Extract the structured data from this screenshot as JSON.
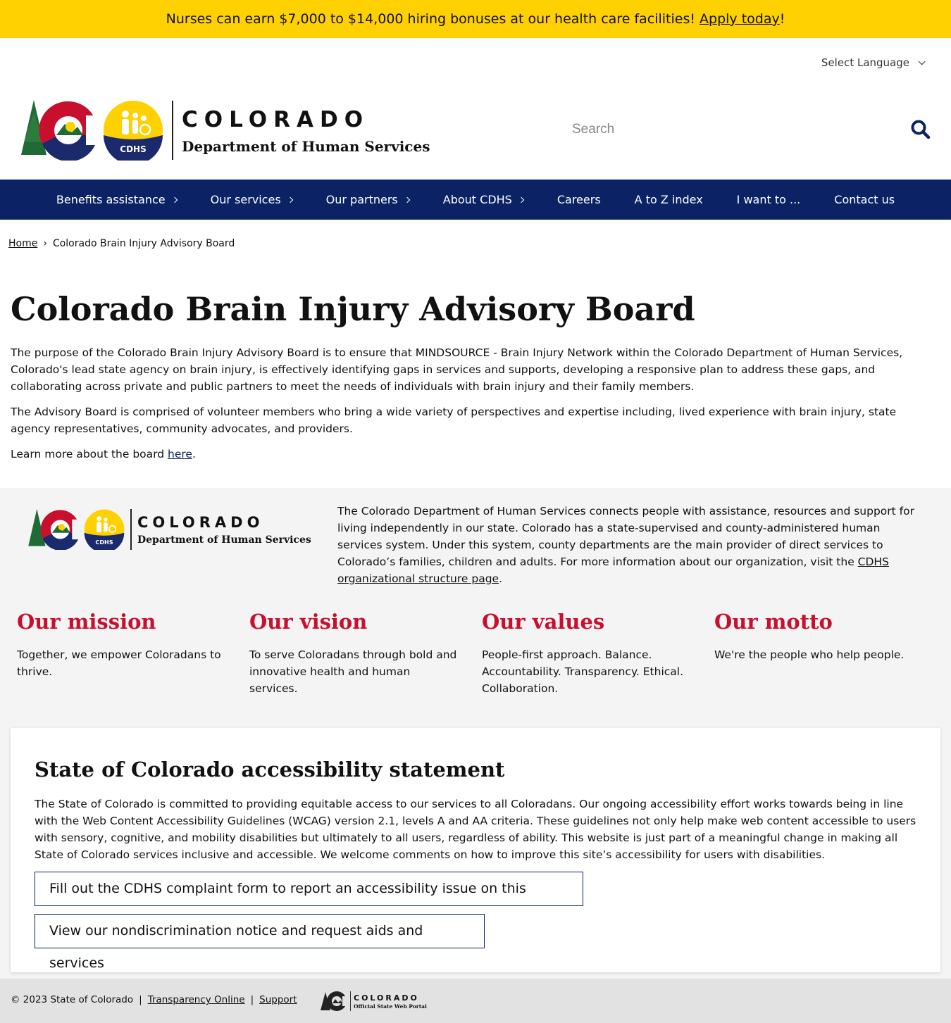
{
  "alert": {
    "text": "Nurses can earn $7,000 to $14,000 hiring bonuses at our health care facilities! ",
    "link": "Apply today",
    "suffix": "!"
  },
  "language": {
    "label": "Select Language",
    "icon": "chevron-down-icon"
  },
  "brand": {
    "colorado": "COLORADO",
    "department": "Department of Human Services",
    "badge": "CDHS"
  },
  "search": {
    "placeholder": "Search",
    "icon": "search-icon"
  },
  "nav": {
    "items": [
      {
        "label": "Benefits assistance",
        "has_submenu": true
      },
      {
        "label": "Our services",
        "has_submenu": true
      },
      {
        "label": "Our partners",
        "has_submenu": true
      },
      {
        "label": "About CDHS",
        "has_submenu": true
      },
      {
        "label": "Careers",
        "has_submenu": false
      },
      {
        "label": "A to Z index",
        "has_submenu": false
      },
      {
        "label": "I want to ...",
        "has_submenu": false
      },
      {
        "label": "Contact us",
        "has_submenu": false
      }
    ]
  },
  "breadcrumb": {
    "home": "Home",
    "separator": "›",
    "current": "Colorado Brain Injury Advisory Board"
  },
  "main": {
    "title": "Colorado Brain Injury Advisory Board",
    "paragraph1": "The purpose of the Colorado Brain Injury Advisory Board is to ensure that MINDSOURCE - Brain Injury Network within the Colorado Department of Human Services, Colorado's lead state agency on brain injury, is effectively identifying gaps in services and supports, developing a responsive plan to address these gaps, and collaborating across private and public partners to meet the needs of individuals with brain injury and their family members.",
    "paragraph2": "The Advisory Board is comprised of volunteer members who bring a wide variety of perspectives and expertise including, lived experience with brain injury, state agency representatives, community advocates, and providers.",
    "paragraph3_prefix": "Learn more about the board ",
    "paragraph3_link": "here",
    "paragraph3_suffix": "."
  },
  "footer": {
    "about_text": "The Colorado Department of Human Services connects people with assistance, resources and support for living independently in our state. Colorado has a state-supervised and county-administered human services system. Under this system, county departments are the main provider of direct services to Colorado’s families, children and adults. For more information about our organization, visit the ",
    "about_link": "CDHS organizational structure page",
    "about_suffix": ".",
    "mission": {
      "title": "Our mission",
      "text": "Together, we empower Coloradans to thrive."
    },
    "vision": {
      "title": "Our vision",
      "text": "To serve Coloradans through bold and innovative health and human services."
    },
    "values": {
      "title": "Our values",
      "text": "People-first approach. Balance. Accountability. Transparency. Ethical. Collaboration."
    },
    "motto": {
      "title": "Our motto",
      "text": "We're the people who help people."
    }
  },
  "accessibility": {
    "title": "State of Colorado accessibility statement",
    "text": "The State of Colorado is committed to providing equitable access to our services to all Coloradans. Our ongoing accessibility effort works towards being in line with the Web Content Accessibility Guidelines (WCAG) version 2.1, levels A and AA criteria. These guidelines not only help make web content accessible to users with sensory, cognitive, and mobility disabilities but ultimately to all users, regardless of ability. This website is just part of a meaningful change in making all State of Colorado services inclusive and accessible. We welcome comments on how to improve this site’s accessibility for users with disabilities.",
    "button1": "Fill out the CDHS complaint form to report an accessibility issue on this website",
    "button2": "View our nondiscrimination notice and request aids and services"
  },
  "bottom": {
    "copyright": "© 2023 State of Colorado",
    "sep": "|",
    "transparency": "Transparency Online",
    "support": "Support",
    "portal_colorado": "COLORADO",
    "portal_sub": "Official State Web Portal"
  },
  "colors": {
    "alert_bg": "#ffd100",
    "nav_bg": "#0b2265",
    "heading_red": "#c8102e",
    "footer_bg": "#f4f4f4"
  }
}
